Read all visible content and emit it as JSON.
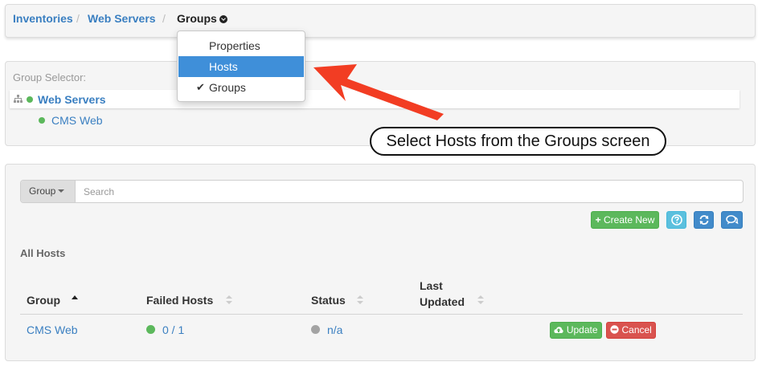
{
  "breadcrumb": {
    "items": [
      "Inventories",
      "Web Servers",
      "Groups"
    ],
    "separator": "/"
  },
  "dropdown": {
    "items": [
      {
        "label": "Properties",
        "selected": false,
        "checked": false
      },
      {
        "label": "Hosts",
        "selected": true,
        "checked": false
      },
      {
        "label": "Groups",
        "selected": false,
        "checked": true
      }
    ]
  },
  "group_selector": {
    "label": "Group Selector:",
    "tree": [
      {
        "label": "Web Servers",
        "status": "green"
      },
      {
        "label": "CMS Web",
        "status": "green"
      }
    ]
  },
  "annotation": {
    "text": "Select Hosts from the Groups screen",
    "arrow_color": "#f23d23"
  },
  "search": {
    "dropdown_label": "Group",
    "placeholder": "Search"
  },
  "actions": {
    "create_new": "Create New"
  },
  "hosts_table": {
    "title": "All Hosts",
    "columns": [
      "Group",
      "Failed Hosts",
      "Status",
      "Last\nUpdated"
    ],
    "rows": [
      {
        "group": "CMS Web",
        "failed_hosts": "0 / 1",
        "status": "n/a",
        "update_label": "Update",
        "cancel_label": "Cancel"
      }
    ]
  },
  "colors": {
    "link": "#3a7fc1",
    "success": "#5cb85c",
    "info": "#5bc0de",
    "primary": "#428bca",
    "danger": "#d9534f",
    "highlight": "#3f8fd9"
  }
}
